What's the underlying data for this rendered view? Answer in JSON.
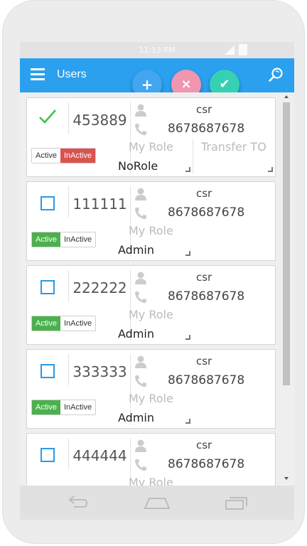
{
  "status_bar": {
    "time": "11:13 PM"
  },
  "app_bar": {
    "title": "Users",
    "menu_icon": "hamburger-menu-icon",
    "search_icon": "search-icon"
  },
  "fab": {
    "add": "+",
    "cancel": "×",
    "confirm": "✔"
  },
  "labels": {
    "my_role": "My Role",
    "transfer_to": "Transfer TO",
    "active": "Active",
    "inactive": "InActive"
  },
  "users": [
    {
      "id": "453889",
      "role_name": "csr",
      "phone": "8678687678",
      "role": "NoRole",
      "checked": true,
      "status": "inactive"
    },
    {
      "id": "111111",
      "role_name": "csr",
      "phone": "8678687678",
      "role": "Admin",
      "checked": false,
      "status": "active"
    },
    {
      "id": "222222",
      "role_name": "csr",
      "phone": "8678687678",
      "role": "Admin",
      "checked": false,
      "status": "active"
    },
    {
      "id": "333333",
      "role_name": "csr",
      "phone": "8678687678",
      "role": "Admin",
      "checked": false,
      "status": "active"
    },
    {
      "id": "444444",
      "role_name": "csr",
      "phone": "8678687678",
      "role": "",
      "checked": false,
      "status": ""
    }
  ],
  "colors": {
    "primary": "#2aa0ef",
    "active_green": "#4bb04e",
    "inactive_red": "#d9534f",
    "fab_add": "#42a5ef",
    "fab_cancel": "#f096b0",
    "fab_confirm": "#35d1b2",
    "check_green": "#3cc44a",
    "checkbox_blue": "#2a9ae8"
  },
  "nav_bar": {
    "back_icon": "back-icon",
    "home_icon": "home-icon",
    "recents_icon": "recents-icon"
  }
}
